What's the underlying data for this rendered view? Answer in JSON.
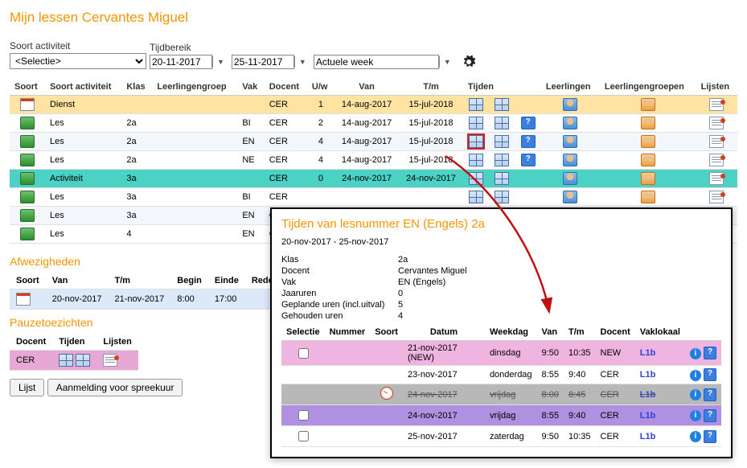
{
  "page_title": "Mijn lessen Cervantes Miguel",
  "filters": {
    "activity_label": "Soort activiteit",
    "activity_value": "<Selectie>",
    "range_label": "Tijdbereik",
    "date_from": "20-11-2017",
    "date_to": "25-11-2017",
    "preset": "Actuele week"
  },
  "lessons": {
    "headers": {
      "soort": "Soort",
      "activiteit": "Soort activiteit",
      "klas": "Klas",
      "groep": "Leerlingengroep",
      "vak": "Vak",
      "docent": "Docent",
      "uw": "U/w",
      "van": "Van",
      "tm": "T/m",
      "tijden": "Tijden",
      "leerlingen": "Leerlingen",
      "groepen": "Leerlingengroepen",
      "lijsten": "Lijsten"
    },
    "rows": [
      {
        "kind": "dienst",
        "ico": "cal",
        "act": "Dienst",
        "klas": "",
        "vak": "",
        "doc": "CER",
        "uw": "1",
        "van": "14-aug-2017",
        "tm": "15-jul-2018",
        "q": false,
        "highlight": false
      },
      {
        "kind": "even",
        "ico": "monitor",
        "act": "Les",
        "klas": "2a",
        "vak": "BI",
        "doc": "CER",
        "uw": "2",
        "van": "14-aug-2017",
        "tm": "15-jul-2018",
        "q": true,
        "highlight": false
      },
      {
        "kind": "odd",
        "ico": "monitor",
        "act": "Les",
        "klas": "2a",
        "vak": "EN",
        "doc": "CER",
        "uw": "4",
        "van": "14-aug-2017",
        "tm": "15-jul-2018",
        "q": true,
        "highlight": true
      },
      {
        "kind": "even",
        "ico": "monitor",
        "act": "Les",
        "klas": "2a",
        "vak": "NE",
        "doc": "CER",
        "uw": "4",
        "van": "14-aug-2017",
        "tm": "15-jul-2018",
        "q": true,
        "highlight": false
      },
      {
        "kind": "teal",
        "ico": "monitor",
        "act": "Activiteit",
        "klas": "3a",
        "vak": "",
        "doc": "CER",
        "uw": "0",
        "van": "24-nov-2017",
        "tm": "24-nov-2017",
        "q": false,
        "highlight": false
      },
      {
        "kind": "even",
        "ico": "monitor",
        "act": "Les",
        "klas": "3a",
        "vak": "BI",
        "doc": "CER",
        "uw": "",
        "van": "",
        "tm": "",
        "q": false,
        "highlight": false
      },
      {
        "kind": "odd",
        "ico": "monitor",
        "act": "Les",
        "klas": "3a",
        "vak": "EN",
        "doc": "CER",
        "uw": "",
        "van": "",
        "tm": "",
        "q": false,
        "highlight": false
      },
      {
        "kind": "even",
        "ico": "monitor",
        "act": "Les",
        "klas": "4",
        "vak": "EN",
        "doc": "CER",
        "uw": "",
        "van": "",
        "tm": "",
        "q": false,
        "highlight": false
      }
    ]
  },
  "absences": {
    "title": "Afwezigheden",
    "headers": {
      "soort": "Soort",
      "van": "Van",
      "tm": "T/m",
      "begin": "Begin",
      "einde": "Einde",
      "reden": "Reden"
    },
    "rows": [
      {
        "van": "20-nov-2017",
        "tm": "21-nov-2017",
        "begin": "8:00",
        "einde": "17:00",
        "reden": ""
      }
    ]
  },
  "pauze": {
    "title": "Pauzetoezichten",
    "headers": {
      "docent": "Docent",
      "tijden": "Tijden",
      "lijsten": "Lijsten"
    },
    "rows": [
      {
        "docent": "CER"
      }
    ]
  },
  "buttons": {
    "lijst": "Lijst",
    "aanmelding": "Aanmelding voor spreekuur"
  },
  "popup": {
    "title": "Tijden van lesnummer EN (Engels) 2a",
    "range": "20-nov-2017 - 25-nov-2017",
    "meta": {
      "klas_k": "Klas",
      "klas_v": "2a",
      "docent_k": "Docent",
      "docent_v": "Cervantes Miguel",
      "vak_k": "Vak",
      "vak_v": "EN (Engels)",
      "jaar_k": "Jaaruren",
      "jaar_v": "0",
      "gepl_k": "Geplande uren (incl.uitval)",
      "gepl_v": "5",
      "geh_k": "Gehouden uren",
      "geh_v": "4"
    },
    "headers": {
      "sel": "Selectie",
      "num": "Nummer",
      "soort": "Soort",
      "datum": "Datum",
      "week": "Weekdag",
      "van": "Van",
      "tm": "T/m",
      "doc": "Docent",
      "lokaal": "Vaklokaal"
    },
    "rows": [
      {
        "cls": "pink",
        "chk": true,
        "clock": false,
        "datum": "21-nov-2017 (NEW)",
        "week": "dinsdag",
        "van": "9:50",
        "tm": "10:35",
        "doc": "NEW",
        "lokaal": "L1b"
      },
      {
        "cls": "white",
        "chk": false,
        "clock": false,
        "datum": "23-nov-2017",
        "week": "donderdag",
        "van": "8:55",
        "tm": "9:40",
        "doc": "CER",
        "lokaal": "L1b"
      },
      {
        "cls": "gray",
        "chk": false,
        "clock": true,
        "datum": "24-nov-2017",
        "week": "vrijdag",
        "van": "8:00",
        "tm": "8:45",
        "doc": "CER",
        "lokaal": "L1b",
        "strike": true
      },
      {
        "cls": "violet",
        "chk": true,
        "clock": false,
        "datum": "24-nov-2017",
        "week": "vrijdag",
        "van": "8:55",
        "tm": "9:40",
        "doc": "CER",
        "lokaal": "L1b"
      },
      {
        "cls": "white",
        "chk": true,
        "clock": false,
        "datum": "25-nov-2017",
        "week": "zaterdag",
        "van": "9:50",
        "tm": "10:35",
        "doc": "CER",
        "lokaal": "L1b"
      }
    ]
  }
}
